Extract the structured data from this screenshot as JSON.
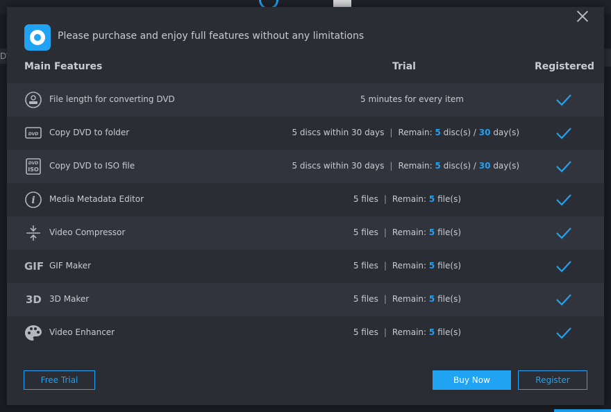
{
  "background": {
    "left_fragment": "DV"
  },
  "dialog": {
    "header_title": "Please purchase and enjoy full features without any limitations",
    "columns": {
      "main": "Main Features",
      "trial": "Trial",
      "registered": "Registered"
    },
    "rows": [
      {
        "icon": "disc-icon",
        "name": "File length for converting DVD",
        "trial_text": "5 minutes for every item"
      },
      {
        "icon": "dvd-folder-icon",
        "name": "Copy DVD to folder",
        "trial_base": "5 discs within 30 days",
        "remain_label": "Remain:",
        "remain_a": "5",
        "unit_a": "disc(s) /",
        "remain_b": "30",
        "unit_b": "day(s)"
      },
      {
        "icon": "dvd-iso-icon",
        "name": "Copy DVD to ISO file",
        "trial_base": "5 discs within 30 days",
        "remain_label": "Remain:",
        "remain_a": "5",
        "unit_a": "disc(s) /",
        "remain_b": "30",
        "unit_b": "day(s)"
      },
      {
        "icon": "info-icon",
        "name": "Media Metadata Editor",
        "trial_base": "5 files",
        "remain_label": "Remain:",
        "remain_a": "5",
        "unit_a": "file(s)"
      },
      {
        "icon": "compress-icon",
        "name": "Video Compressor",
        "trial_base": "5 files",
        "remain_label": "Remain:",
        "remain_a": "5",
        "unit_a": "file(s)"
      },
      {
        "icon": "gif-icon",
        "icon_text": "GIF",
        "name": "GIF Maker",
        "trial_base": "5 files",
        "remain_label": "Remain:",
        "remain_a": "5",
        "unit_a": "file(s)"
      },
      {
        "icon": "3d-icon",
        "icon_text": "3D",
        "name": "3D Maker",
        "trial_base": "5 files",
        "remain_label": "Remain:",
        "remain_a": "5",
        "unit_a": "file(s)"
      },
      {
        "icon": "palette-icon",
        "name": "Video Enhancer",
        "trial_base": "5 files",
        "remain_label": "Remain:",
        "remain_a": "5",
        "unit_a": "file(s)"
      }
    ],
    "buttons": {
      "free_trial": "Free Trial",
      "buy_now": "Buy Now",
      "register": "Register"
    },
    "colors": {
      "accent": "#1fa3f2",
      "dialog_bg": "#2b2d35",
      "row_alt_bg": "#32343d"
    }
  }
}
